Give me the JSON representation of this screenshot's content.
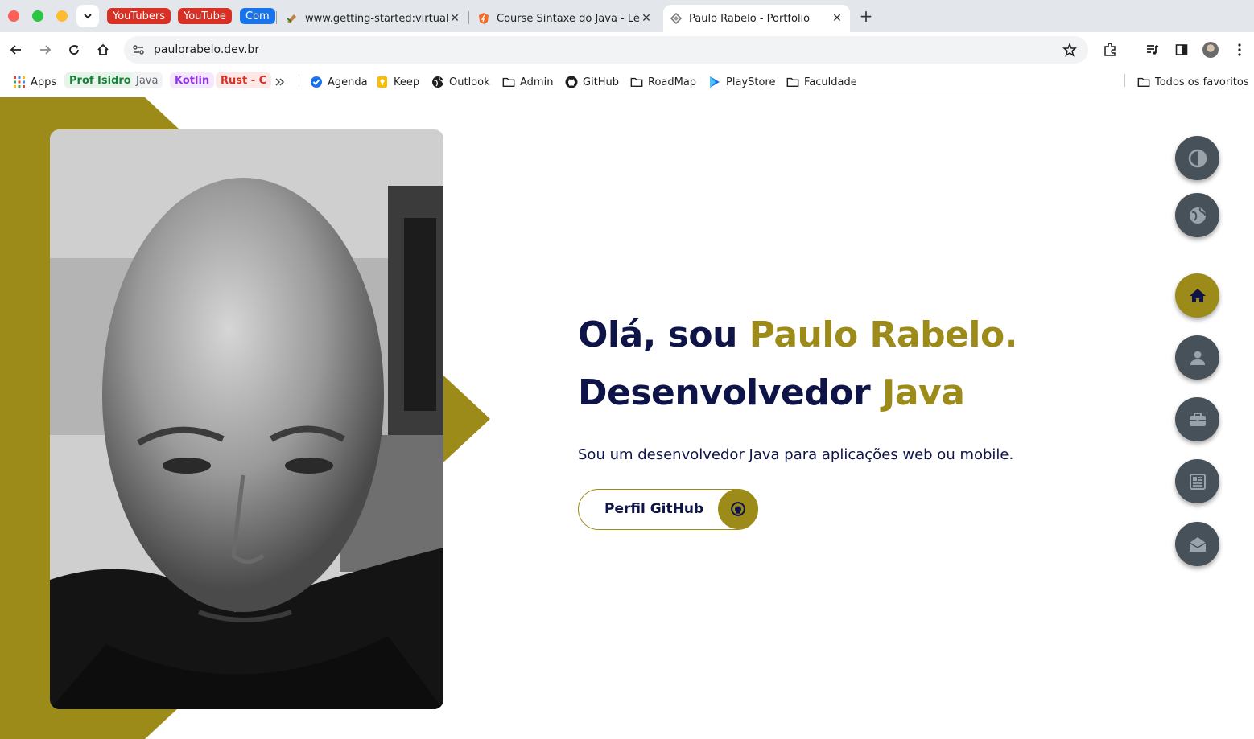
{
  "browser": {
    "tab_groups": [
      {
        "label": "YouTubers",
        "color": "#d93025"
      },
      {
        "label": "YouTube",
        "color": "#d93025"
      },
      {
        "label": "Com",
        "color": "#1a73e8"
      }
    ],
    "tabs": [
      {
        "title": "www.getting-started:virtual",
        "active": false
      },
      {
        "title": "Course Sintaxe do Java - Lec",
        "active": false
      },
      {
        "title": "Paulo Rabelo - Portfolio",
        "active": true
      }
    ],
    "url": "paulorabelo.dev.br",
    "bookmarks": {
      "apps": "Apps",
      "chips": [
        {
          "label": "Prof Isidro",
          "color": "#188038",
          "bg": "#e6f4ea"
        },
        {
          "label": "Java",
          "color": "#5f6368",
          "bg": "#f1f3f4"
        },
        {
          "label": "Kotlin",
          "color": "#9334e6",
          "bg": "#f3e8fd"
        },
        {
          "label": "Rust - C",
          "color": "#d93025",
          "bg": "#fce8e6"
        }
      ],
      "items": [
        {
          "label": "Agenda",
          "icon": "calendar-check-icon"
        },
        {
          "label": "Keep",
          "icon": "keep-icon"
        },
        {
          "label": "Outlook",
          "icon": "globe-icon"
        },
        {
          "label": "Admin",
          "icon": "folder-icon"
        },
        {
          "label": "GitHub",
          "icon": "github-icon"
        },
        {
          "label": "RoadMap",
          "icon": "folder-icon"
        },
        {
          "label": "PlayStore",
          "icon": "playstore-icon"
        },
        {
          "label": "Faculdade",
          "icon": "folder-icon"
        }
      ],
      "all_bookmarks": "Todos os favoritos"
    }
  },
  "hero": {
    "greeting": "Olá, sou ",
    "name": "Paulo Rabelo.",
    "role_prefix": "Desenvolvedor ",
    "role_accent": "Java",
    "description": "Sou um desenvolvedor Java para aplicações web ou mobile.",
    "button_label": "Perfil GitHub"
  },
  "colors": {
    "navy": "#0e1447",
    "gold": "#9c8a19",
    "fab": "#475159"
  },
  "side_nav": [
    {
      "icon": "contrast-icon",
      "active": false
    },
    {
      "icon": "globe-icon",
      "active": false
    },
    {
      "icon": "home-icon",
      "active": true
    },
    {
      "icon": "user-icon",
      "active": false
    },
    {
      "icon": "briefcase-icon",
      "active": false
    },
    {
      "icon": "newspaper-icon",
      "active": false
    },
    {
      "icon": "envelope-open-icon",
      "active": false
    }
  ]
}
